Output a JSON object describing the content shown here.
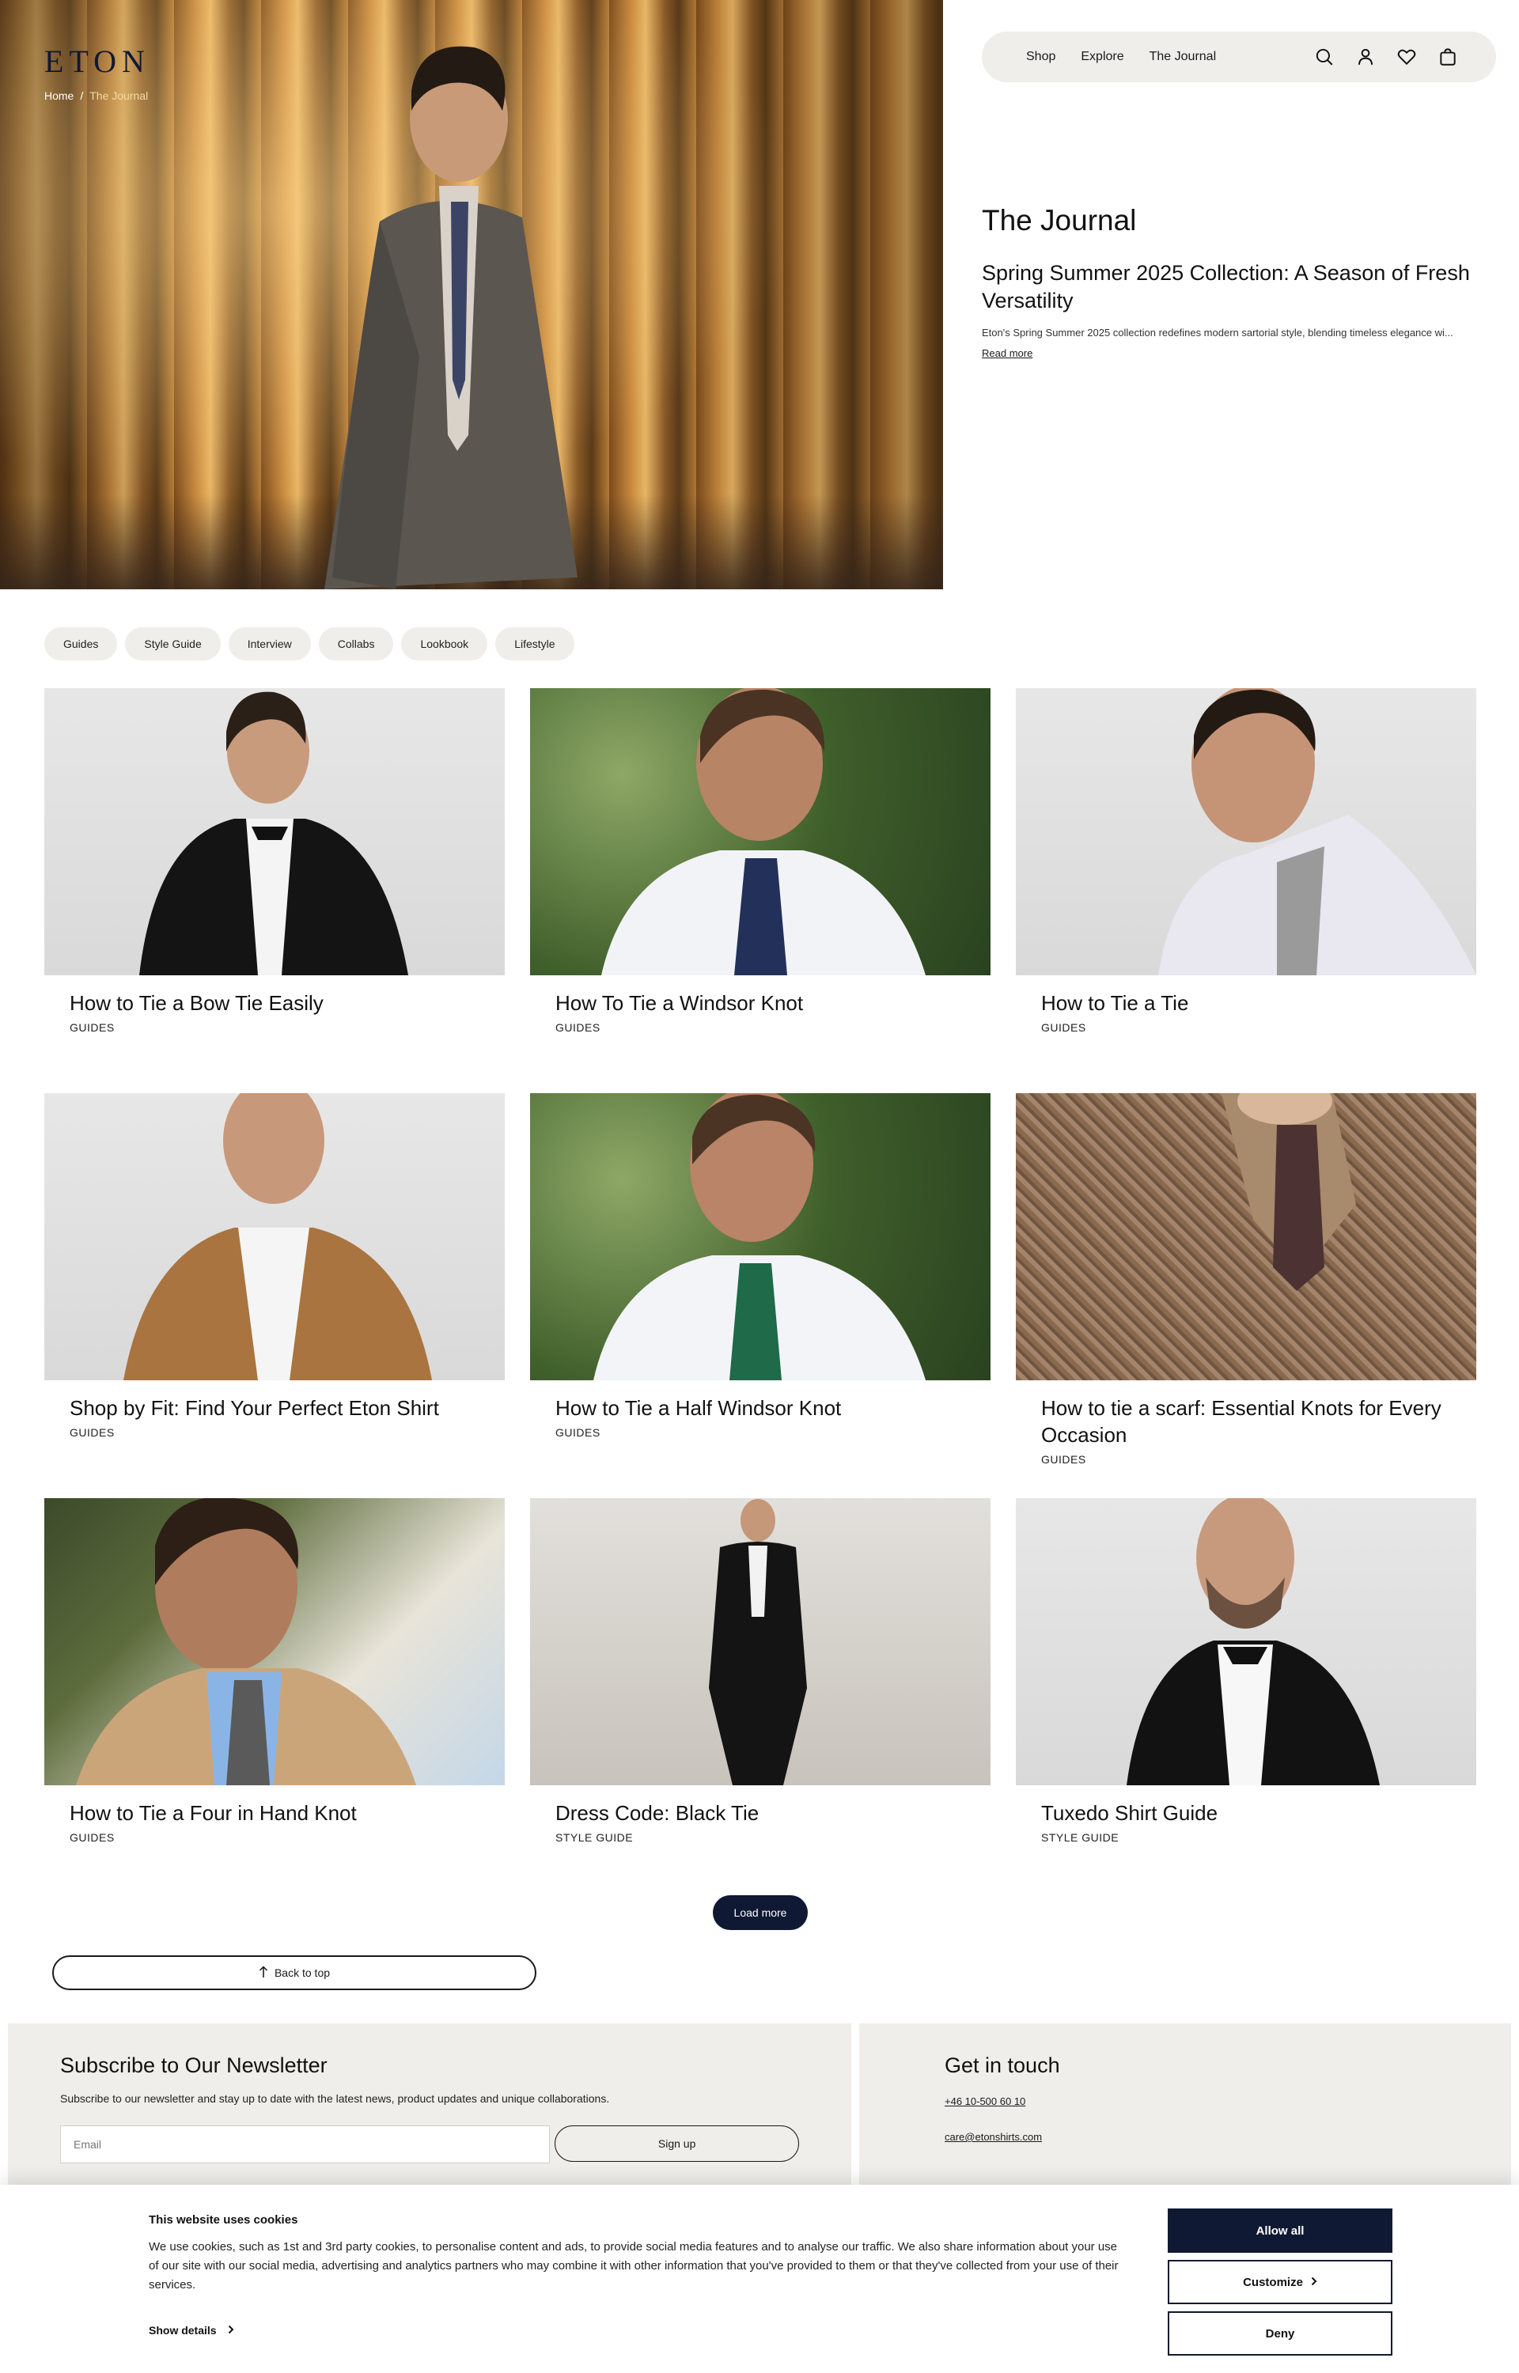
{
  "brand": {
    "logo": "ETON",
    "navy": "#0f1933",
    "surface": "#efeeea"
  },
  "breadcrumb": {
    "home": "Home",
    "separator": "/",
    "current": "The Journal"
  },
  "nav": {
    "links": [
      "Shop",
      "Explore",
      "The Journal"
    ],
    "icons": [
      "search-icon",
      "account-icon",
      "wishlist-heart-icon",
      "shopping-bag-icon"
    ]
  },
  "hero": {
    "section_title": "The Journal",
    "article_title": "Spring Summer 2025 Collection: A Season of Fresh Versatility",
    "excerpt": "Eton's Spring Summer 2025 collection redefines modern sartorial style, blending timeless elegance wi...",
    "read_more": "Read more"
  },
  "filters": [
    "Guides",
    "Style Guide",
    "Interview",
    "Collabs",
    "Lookbook",
    "Lifestyle"
  ],
  "articles": [
    {
      "title": "How to Tie a Bow Tie Easily",
      "tag": "GUIDES"
    },
    {
      "title": "How To Tie a Windsor Knot",
      "tag": "GUIDES"
    },
    {
      "title": "How to Tie a Tie",
      "tag": "GUIDES"
    },
    {
      "title": "Shop by Fit: Find Your Perfect Eton Shirt",
      "tag": "GUIDES"
    },
    {
      "title": "How to Tie a Half Windsor Knot",
      "tag": "GUIDES"
    },
    {
      "title": "How to tie a scarf: Essential Knots for Every Occasion",
      "tag": "GUIDES"
    },
    {
      "title": "How to Tie a Four in Hand Knot",
      "tag": "GUIDES"
    },
    {
      "title": "Dress Code: Black Tie",
      "tag": "STYLE GUIDE"
    },
    {
      "title": "Tuxedo Shirt Guide",
      "tag": "STYLE GUIDE"
    }
  ],
  "load_more": "Load more",
  "back_to_top": "Back to top",
  "newsletter": {
    "title": "Subscribe to Our Newsletter",
    "text": "Subscribe to our newsletter and stay up to date with the latest news, product updates and unique collaborations.",
    "placeholder": "Email",
    "button": "Sign up"
  },
  "contact": {
    "title": "Get in touch",
    "phone": "+46 10-500 60 10",
    "email": "care@etonshirts.com"
  },
  "cookie": {
    "title": "This website uses cookies",
    "text": "We use cookies, such as 1st and 3rd party cookies, to personalise content and ads, to provide social media features and to analyse our traffic. We also share information about your use of our site with our social media, advertising and analytics partners who may combine it with other information that you've provided to them or that they've collected from your use of their services.",
    "show_details": "Show details",
    "allow_all": "Allow all",
    "customize": "Customize",
    "deny": "Deny"
  }
}
